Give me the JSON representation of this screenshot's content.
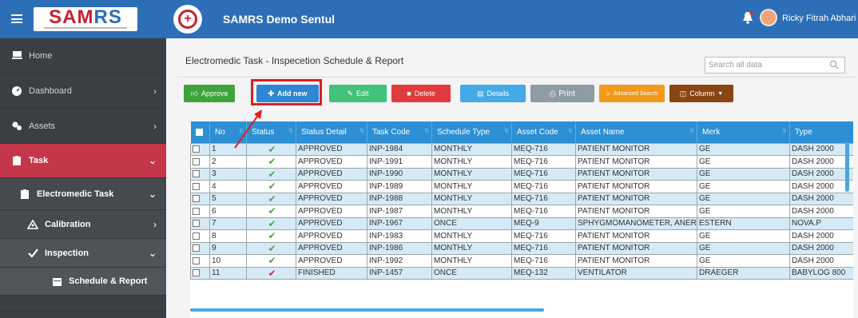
{
  "sidebar": {
    "logo_text_1": "SAM",
    "logo_text_2": "RS",
    "items": [
      {
        "label": "Home"
      },
      {
        "label": "Dashboard"
      },
      {
        "label": "Assets"
      },
      {
        "label": "Task"
      },
      {
        "label": "Electromedic Task"
      },
      {
        "label": "Calibration"
      },
      {
        "label": "Inspection"
      },
      {
        "label": "Schedule & Report"
      }
    ]
  },
  "header": {
    "app_title": "SAMRS Demo Sentul",
    "user_name": "Ricky Fitrah Abhari"
  },
  "main": {
    "page_title": "Electromedic Task - Inspecetion Schedule & Report",
    "search_placeholder": "Search all data"
  },
  "toolbar": {
    "approve": "Approve",
    "add_new": "Add new",
    "edit": "Edit",
    "delete": "Delete",
    "details": "Details",
    "print": "Print",
    "advanced_search": "Advanced Search",
    "column": "Column"
  },
  "table": {
    "headers": [
      "No",
      "Status",
      "Status Detail",
      "Task Code",
      "Schedule Type",
      "Asset Code",
      "Asset Name",
      "Merk",
      "Type"
    ],
    "rows": [
      [
        "1",
        "ok",
        "APPROVED",
        "INP-1984",
        "MONTHLY",
        "MEQ-716",
        "PATIENT MONITOR",
        "GE",
        "DASH 2000"
      ],
      [
        "2",
        "ok",
        "APPROVED",
        "INP-1991",
        "MONTHLY",
        "MEQ-716",
        "PATIENT MONITOR",
        "GE",
        "DASH 2000"
      ],
      [
        "3",
        "ok",
        "APPROVED",
        "INP-1990",
        "MONTHLY",
        "MEQ-716",
        "PATIENT MONITOR",
        "GE",
        "DASH 2000"
      ],
      [
        "4",
        "ok",
        "APPROVED",
        "INP-1989",
        "MONTHLY",
        "MEQ-716",
        "PATIENT MONITOR",
        "GE",
        "DASH 2000"
      ],
      [
        "5",
        "ok",
        "APPROVED",
        "INP-1988",
        "MONTHLY",
        "MEQ-716",
        "PATIENT MONITOR",
        "GE",
        "DASH 2000"
      ],
      [
        "6",
        "ok",
        "APPROVED",
        "INP-1987",
        "MONTHLY",
        "MEQ-716",
        "PATIENT MONITOR",
        "GE",
        "DASH 2000"
      ],
      [
        "7",
        "ok",
        "APPROVED",
        "INP-1967",
        "ONCE",
        "MEQ-9",
        "SPHYGMOMANOMETER, ANEROID",
        "ESTERN",
        "NOVA.P"
      ],
      [
        "8",
        "ok",
        "APPROVED",
        "INP-1983",
        "MONTHLY",
        "MEQ-716",
        "PATIENT MONITOR",
        "GE",
        "DASH 2000"
      ],
      [
        "9",
        "ok",
        "APPROVED",
        "INP-1986",
        "MONTHLY",
        "MEQ-716",
        "PATIENT MONITOR",
        "GE",
        "DASH 2000"
      ],
      [
        "10",
        "ok",
        "APPROVED",
        "INP-1992",
        "MONTHLY",
        "MEQ-716",
        "PATIENT MONITOR",
        "GE",
        "DASH 2000"
      ],
      [
        "11",
        "red",
        "FINISHED",
        "INP-1457",
        "ONCE",
        "MEQ-132",
        "VENTILATOR",
        "DRAEGER",
        "BABYLOG 800"
      ]
    ]
  },
  "colors": {
    "brand_blue": "#2d6fb7",
    "task_red": "#c4364a",
    "table_header": "#2d8fd4",
    "row_alt": "#d6eaf6",
    "highlight": "#e01e1e"
  },
  "icons": [
    "hamburger-icon",
    "home-icon",
    "dashboard-icon",
    "assets-icon",
    "task-icon",
    "calibration-icon",
    "check-icon",
    "bell-icon",
    "search-icon"
  ]
}
